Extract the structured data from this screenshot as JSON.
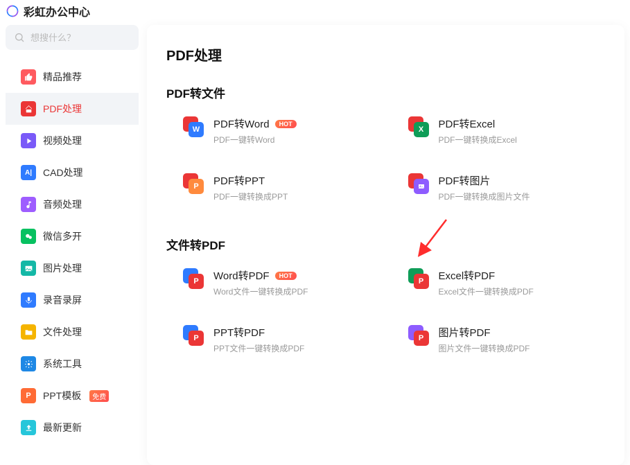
{
  "app_title": "彩虹办公中心",
  "search": {
    "placeholder": "想搜什么？"
  },
  "sidebar": {
    "items": [
      {
        "label": "精品推荐",
        "icon_bg": "#ff5a5f",
        "icon": "thumb"
      },
      {
        "label": "PDF处理",
        "icon_bg": "#eb3636",
        "icon": "pdf",
        "active": true
      },
      {
        "label": "视频处理",
        "icon_bg": "#7a5af8",
        "icon": "play"
      },
      {
        "label": "CAD处理",
        "icon_bg": "#2f7bff",
        "icon": "cad"
      },
      {
        "label": "音频处理",
        "icon_bg": "#9e5dff",
        "icon": "music"
      },
      {
        "label": "微信多开",
        "icon_bg": "#07c160",
        "icon": "wechat"
      },
      {
        "label": "图片处理",
        "icon_bg": "#14b8a6",
        "icon": "image"
      },
      {
        "label": "录音录屏",
        "icon_bg": "#2f7bff",
        "icon": "mic"
      },
      {
        "label": "文件处理",
        "icon_bg": "#f5b400",
        "icon": "folder"
      },
      {
        "label": "系统工具",
        "icon_bg": "#1e88e5",
        "icon": "gear"
      },
      {
        "label": "PPT模板",
        "icon_bg": "#ff6b35",
        "icon": "ppt",
        "badge": "免费"
      },
      {
        "label": "最新更新",
        "icon_bg": "#26c6da",
        "icon": "upload"
      }
    ]
  },
  "page_title": "PDF处理",
  "sections": [
    {
      "title": "PDF转文件",
      "tools": [
        {
          "title": "PDF转Word",
          "desc": "PDF一键转Word",
          "hot": true,
          "back": "#eb3636",
          "front": "#2f7bff",
          "letter": "W"
        },
        {
          "title": "PDF转Excel",
          "desc": "PDF一键转换成Excel",
          "hot": false,
          "back": "#eb3636",
          "front": "#0f9d58",
          "letter": "X"
        },
        {
          "title": "PDF转PPT",
          "desc": "PDF一键转换成PPT",
          "hot": false,
          "back": "#eb3636",
          "front": "#ff8a3d",
          "letter": "P"
        },
        {
          "title": "PDF转图片",
          "desc": "PDF一键转换成图片文件",
          "hot": false,
          "back": "#eb3636",
          "front": "#8e5cff",
          "letter": ""
        }
      ]
    },
    {
      "title": "文件转PDF",
      "tools": [
        {
          "title": "Word转PDF",
          "desc": "Word文件一键转换成PDF",
          "hot": true,
          "back": "#2f7bff",
          "front": "#eb3636",
          "letter": "P"
        },
        {
          "title": "Excel转PDF",
          "desc": "Excel文件一键转换成PDF",
          "hot": false,
          "back": "#0f9d58",
          "front": "#eb3636",
          "letter": "P"
        },
        {
          "title": "PPT转PDF",
          "desc": "PPT文件一键转换成PDF",
          "hot": false,
          "back": "#2f7bff",
          "front": "#eb3636",
          "letter": "P"
        },
        {
          "title": "图片转PDF",
          "desc": "图片文件一键转换成PDF",
          "hot": false,
          "back": "#8e5cff",
          "front": "#eb3636",
          "letter": "P"
        }
      ]
    }
  ]
}
